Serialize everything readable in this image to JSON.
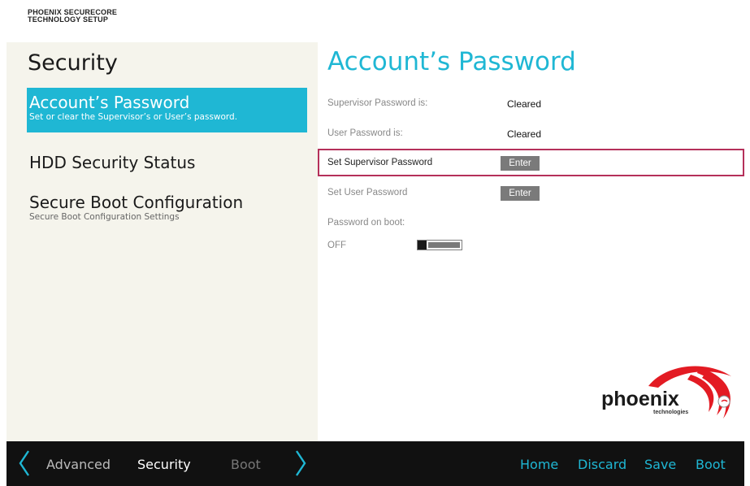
{
  "brand": {
    "line1": "PHOENIX SECURECORE",
    "line2": "TECHNOLOGY SETUP"
  },
  "sidebar": {
    "section_title": "Security",
    "items": [
      {
        "title": "Account’s Password",
        "desc": "Set or clear the Supervisor’s or User’s password.",
        "selected": true
      },
      {
        "title": "HDD Security Status",
        "desc": ""
      },
      {
        "title": "Secure Boot Configuration",
        "desc": "Secure Boot Configuration Settings"
      }
    ]
  },
  "main": {
    "title": "Account’s Password",
    "supervisor_status_label": "Supervisor Password is:",
    "supervisor_status_value": "Cleared",
    "user_status_label": "User Password is:",
    "user_status_value": "Cleared",
    "set_supervisor_label": "Set Supervisor Password",
    "set_supervisor_button": "Enter",
    "set_user_label": "Set User Password",
    "set_user_button": "Enter",
    "password_on_boot_label": "Password on boot:",
    "password_on_boot_value": "OFF"
  },
  "logo": {
    "word": "phoenix",
    "sub": "technologies"
  },
  "bottom_bar": {
    "tabs": [
      "Advanced",
      "Security",
      "Boot"
    ],
    "active_tab": "Security",
    "actions": [
      "Home",
      "Discard",
      "Save",
      "Boot"
    ]
  },
  "colors": {
    "accent": "#1fb7d4",
    "focus": "#b5305a",
    "bar": "#111111",
    "panel": "#f5f4ec",
    "logo_red": "#e31b23"
  }
}
